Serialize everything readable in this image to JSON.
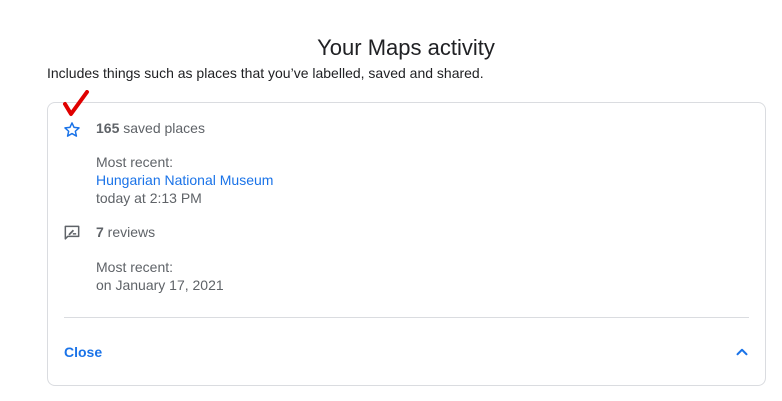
{
  "header": {
    "title": "Your Maps activity",
    "subtitle": "Includes things such as places that you’ve labelled, saved and shared."
  },
  "saved_places": {
    "count": "165",
    "count_suffix": " saved places",
    "recent_label": "Most recent:",
    "recent_place": "Hungarian National Museum",
    "recent_time": "today at 2:13 PM"
  },
  "reviews": {
    "count": "7",
    "count_suffix": " reviews",
    "recent_label": "Most recent:",
    "recent_time": "on January 17, 2021"
  },
  "footer": {
    "close_label": "Close"
  },
  "icons": {
    "saved": "star-outline-icon",
    "reviews": "rate-review-icon",
    "collapse": "chevron-up-icon",
    "annotation": "red-checkmark"
  },
  "colors": {
    "accent": "#1a73e8",
    "mark": "#e00000",
    "border": "#dadce0"
  }
}
